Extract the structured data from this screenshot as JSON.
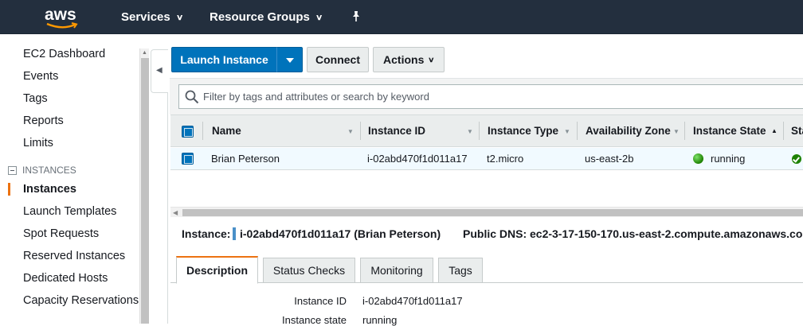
{
  "topbar": {
    "logo": "aws",
    "nav": [
      {
        "label": "Services"
      },
      {
        "label": "Resource Groups"
      }
    ],
    "pin_icon": "pin-icon"
  },
  "sidebar": {
    "items": [
      {
        "label": "EC2 Dashboard"
      },
      {
        "label": "Events"
      },
      {
        "label": "Tags"
      },
      {
        "label": "Reports"
      },
      {
        "label": "Limits"
      }
    ],
    "section": "INSTANCES",
    "section_items": [
      {
        "label": "Instances",
        "active": true
      },
      {
        "label": "Launch Templates"
      },
      {
        "label": "Spot Requests"
      },
      {
        "label": "Reserved Instances"
      },
      {
        "label": "Dedicated Hosts"
      },
      {
        "label": "Capacity Reservations"
      }
    ]
  },
  "toolbar": {
    "launch_label": "Launch Instance",
    "connect_label": "Connect",
    "actions_label": "Actions"
  },
  "search": {
    "placeholder": "Filter by tags and attributes or search by keyword",
    "value": ""
  },
  "table": {
    "columns": [
      "Name",
      "Instance ID",
      "Instance Type",
      "Availability Zone",
      "Instance State",
      "Sta"
    ],
    "rows": [
      {
        "name": "Brian Peterson",
        "instance_id": "i-02abd470f1d011a17",
        "instance_type": "t2.micro",
        "availability_zone": "us-east-2b",
        "instance_state": "running",
        "selected": true
      }
    ]
  },
  "detail": {
    "instance_label": "Instance:",
    "instance_value": "i-02abd470f1d011a17 (Brian Peterson)",
    "dns_label": "Public DNS:",
    "dns_value": "ec2-3-17-150-170.us-east-2.compute.amazonaws.co",
    "tabs": [
      "Description",
      "Status Checks",
      "Monitoring",
      "Tags"
    ],
    "active_tab": "Description",
    "fields": [
      {
        "label": "Instance ID",
        "value": "i-02abd470f1d011a17"
      },
      {
        "label": "Instance state",
        "value": "running"
      }
    ]
  },
  "colors": {
    "topbar": "#232f3e",
    "primary": "#0073bb",
    "accent": "#ec7211",
    "running": "#1d8102"
  }
}
